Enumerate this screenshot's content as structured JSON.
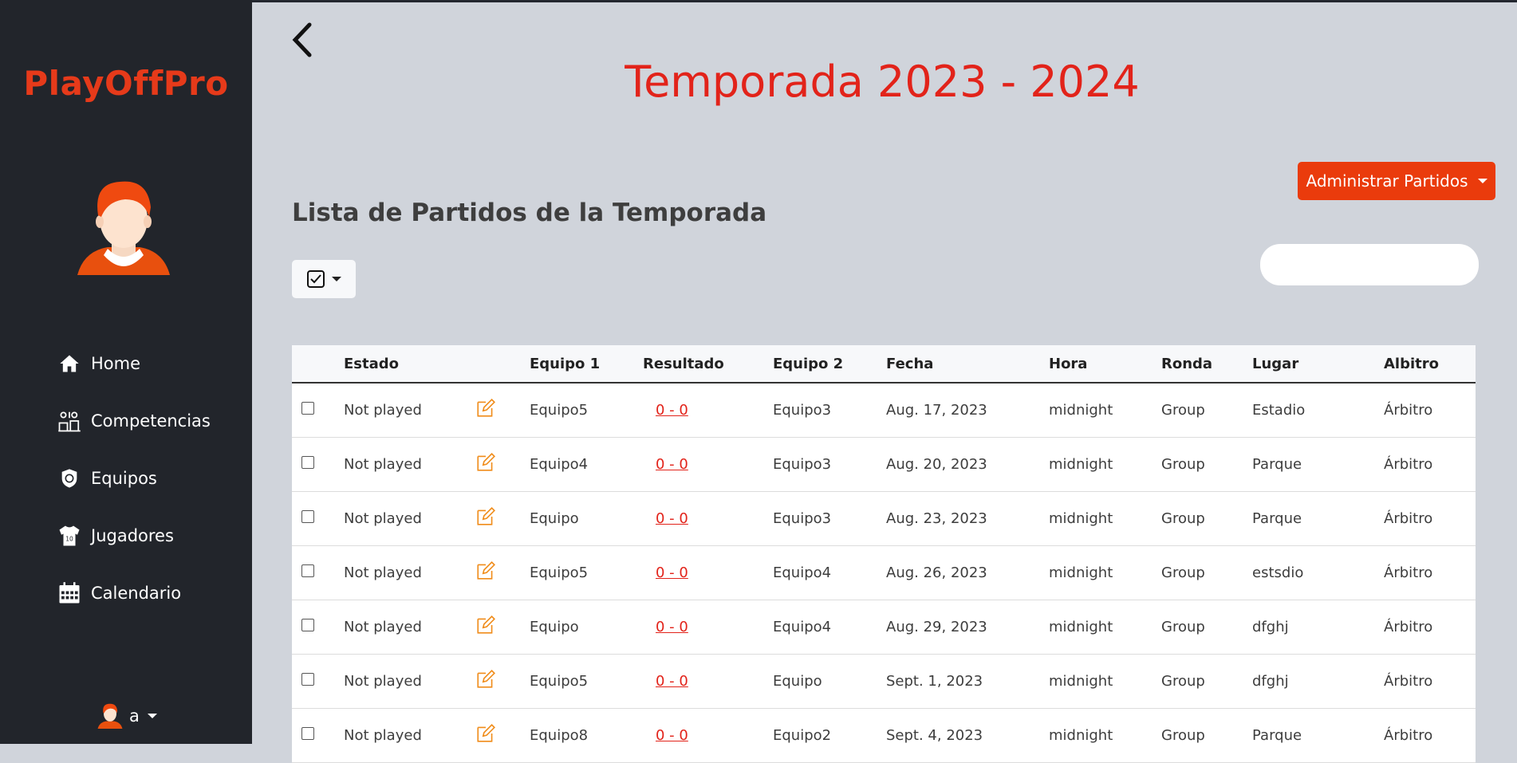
{
  "brand": "PlayOffPro",
  "nav": [
    {
      "label": "Home",
      "icon": "home-icon"
    },
    {
      "label": "Competencias",
      "icon": "competitions-icon"
    },
    {
      "label": "Equipos",
      "icon": "team-shield-icon"
    },
    {
      "label": "Jugadores",
      "icon": "jersey-icon"
    },
    {
      "label": "Calendario",
      "icon": "calendar-icon"
    }
  ],
  "user": {
    "name": "a"
  },
  "page": {
    "title": "Temporada 2023 - 2024",
    "admin_button": "Administrar Partidos",
    "list_title": "Lista de Partidos de la Temporada",
    "search_placeholder": ""
  },
  "table": {
    "headers": [
      "",
      "Estado",
      "",
      "Equipo 1",
      "Resultado",
      "Equipo 2",
      "Fecha",
      "Hora",
      "Ronda",
      "Lugar",
      "Albitro"
    ],
    "rows": [
      {
        "estado": "Not played",
        "equipo1": "Equipo5",
        "resultado": "0 - 0",
        "equipo2": "Equipo3",
        "fecha": "Aug. 17, 2023",
        "hora": "midnight",
        "ronda": "Group",
        "lugar": "Estadio",
        "arbitro": "Árbitro"
      },
      {
        "estado": "Not played",
        "equipo1": "Equipo4",
        "resultado": "0 - 0",
        "equipo2": "Equipo3",
        "fecha": "Aug. 20, 2023",
        "hora": "midnight",
        "ronda": "Group",
        "lugar": "Parque",
        "arbitro": "Árbitro"
      },
      {
        "estado": "Not played",
        "equipo1": "Equipo",
        "resultado": "0 - 0",
        "equipo2": "Equipo3",
        "fecha": "Aug. 23, 2023",
        "hora": "midnight",
        "ronda": "Group",
        "lugar": "Parque",
        "arbitro": "Árbitro"
      },
      {
        "estado": "Not played",
        "equipo1": "Equipo5",
        "resultado": "0 - 0",
        "equipo2": "Equipo4",
        "fecha": "Aug. 26, 2023",
        "hora": "midnight",
        "ronda": "Group",
        "lugar": "estsdio",
        "arbitro": "Árbitro"
      },
      {
        "estado": "Not played",
        "equipo1": "Equipo",
        "resultado": "0 - 0",
        "equipo2": "Equipo4",
        "fecha": "Aug. 29, 2023",
        "hora": "midnight",
        "ronda": "Group",
        "lugar": "dfghj",
        "arbitro": "Árbitro"
      },
      {
        "estado": "Not played",
        "equipo1": "Equipo5",
        "resultado": "0 - 0",
        "equipo2": "Equipo",
        "fecha": "Sept. 1, 2023",
        "hora": "midnight",
        "ronda": "Group",
        "lugar": "dfghj",
        "arbitro": "Árbitro"
      },
      {
        "estado": "Not played",
        "equipo1": "Equipo8",
        "resultado": "0 - 0",
        "equipo2": "Equipo2",
        "fecha": "Sept. 4, 2023",
        "hora": "midnight",
        "ronda": "Group",
        "lugar": "Parque",
        "arbitro": "Árbitro"
      }
    ]
  },
  "colors": {
    "accent": "#e2231a",
    "button": "#ea3b0c",
    "sidebar": "#22252b",
    "background": "#d0d4db",
    "edit_icon": "#f08c1a"
  }
}
